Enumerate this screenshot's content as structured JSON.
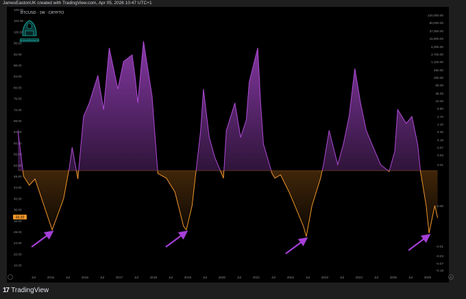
{
  "header": {
    "attribution": "JamesEastonUK created with TradingView.com, Apr 05, 2026 10:47 UTC+1"
  },
  "symbol_label": "BTCUSD · 1W · CRYPTO",
  "logo": {
    "handle": "@JamesEastonUK",
    "color": "#19c3b9"
  },
  "footer": {
    "brand": "TradingView",
    "brand_mark": "17"
  },
  "colors": {
    "above": "#b04bd8",
    "below": "#f0962a",
    "arrow": "#a63fd8",
    "background": "#000000"
  },
  "chart_data": {
    "type": "area",
    "title": "",
    "threshold": 50,
    "ylim": [
      14,
      110
    ],
    "left_axis_ticks": [
      "108.00",
      "104.00",
      "100.00",
      "96.00",
      "92.00",
      "88.00",
      "84.00",
      "80.00",
      "76.00",
      "72.00",
      "68.00",
      "64.00",
      "60.00",
      "56.00",
      "52.00",
      "48.00",
      "44.00",
      "40.00",
      "36.00",
      "32.00",
      "28.00",
      "24.00",
      "20.00",
      "16.00"
    ],
    "right_axis_ticks": [
      "220,000.00",
      "80,000.00",
      "37,000.00",
      "15,500.00",
      "6,300.00",
      "2,700.00",
      "1,100.00",
      "460.00",
      "200.00",
      "80.00",
      "35.00",
      "15.00",
      "6.50",
      "2.70",
      "1.10",
      "0.45",
      "0.19",
      "0.07",
      "0.03",
      "0.01",
      "−0.00",
      "−0.01",
      "−0.03",
      "−0.07",
      "−0.18"
    ],
    "x_axis_ticks": [
      "Jul",
      "2015",
      "Jul",
      "2016",
      "Jul",
      "2017",
      "Jul",
      "2018",
      "Jul",
      "2019",
      "Jul",
      "2020",
      "Jul",
      "2021",
      "Jul",
      "2022",
      "Jul",
      "2023",
      "Jul",
      "2024",
      "Jul",
      "2025",
      "Jul",
      "2026"
    ],
    "current_value_label": "33.20",
    "arrows_point_to": [
      "2015-01",
      "2018-12",
      "2022-06",
      "2026-01"
    ],
    "points": [
      [
        "2014-01",
        64.5
      ],
      [
        "2014-03",
        48
      ],
      [
        "2014-05",
        44.8
      ],
      [
        "2014-07",
        47
      ],
      [
        "2015-01",
        28.7
      ],
      [
        "2015-05",
        39.9
      ],
      [
        "2015-07",
        51
      ],
      [
        "2015-08",
        58.4
      ],
      [
        "2015-10",
        47
      ],
      [
        "2015-12",
        69.5
      ],
      [
        "2016-02",
        74.4
      ],
      [
        "2016-05",
        84.3
      ],
      [
        "2016-07",
        72
      ],
      [
        "2016-09",
        94.2
      ],
      [
        "2016-12",
        79.4
      ],
      [
        "2017-02",
        89.3
      ],
      [
        "2017-05",
        91.7
      ],
      [
        "2017-06",
        84.3
      ],
      [
        "2017-07",
        74.4
      ],
      [
        "2017-09",
        96.6
      ],
      [
        "2017-12",
        76.9
      ],
      [
        "2018-02",
        49
      ],
      [
        "2018-05",
        47.3
      ],
      [
        "2018-08",
        42.3
      ],
      [
        "2018-11",
        30
      ],
      [
        "2018-12",
        28.7
      ],
      [
        "2019-02",
        37.4
      ],
      [
        "2019-05",
        64.5
      ],
      [
        "2019-06",
        79.4
      ],
      [
        "2019-08",
        62
      ],
      [
        "2019-10",
        54.7
      ],
      [
        "2020-01",
        47.3
      ],
      [
        "2020-02",
        64.5
      ],
      [
        "2020-05",
        74.4
      ],
      [
        "2020-07",
        62
      ],
      [
        "2020-09",
        68.2
      ],
      [
        "2020-10",
        81.8
      ],
      [
        "2021-01",
        94.2
      ],
      [
        "2021-02",
        74.4
      ],
      [
        "2021-03",
        59.6
      ],
      [
        "2021-06",
        49
      ],
      [
        "2021-07",
        47.3
      ],
      [
        "2021-09",
        48.5
      ],
      [
        "2021-12",
        42.3
      ],
      [
        "2022-02",
        37.4
      ],
      [
        "2022-05",
        30
      ],
      [
        "2022-06",
        26.3
      ],
      [
        "2022-08",
        37.4
      ],
      [
        "2022-11",
        47.3
      ],
      [
        "2022-12",
        52
      ],
      [
        "2023-02",
        64.5
      ],
      [
        "2023-05",
        52.2
      ],
      [
        "2023-07",
        59.6
      ],
      [
        "2023-09",
        69.5
      ],
      [
        "2023-11",
        86.8
      ],
      [
        "2024-01",
        74.4
      ],
      [
        "2024-03",
        64.5
      ],
      [
        "2024-06",
        57.1
      ],
      [
        "2024-08",
        52.2
      ],
      [
        "2024-11",
        49.7
      ],
      [
        "2025-01",
        57
      ],
      [
        "2025-02",
        72
      ],
      [
        "2025-05",
        67
      ],
      [
        "2025-07",
        69.5
      ],
      [
        "2025-09",
        59.6
      ],
      [
        "2025-10",
        49.7
      ],
      [
        "2025-12",
        37.4
      ],
      [
        "2026-01",
        27.5
      ],
      [
        "2026-03",
        37.4
      ],
      [
        "2026-04",
        33
      ]
    ]
  }
}
